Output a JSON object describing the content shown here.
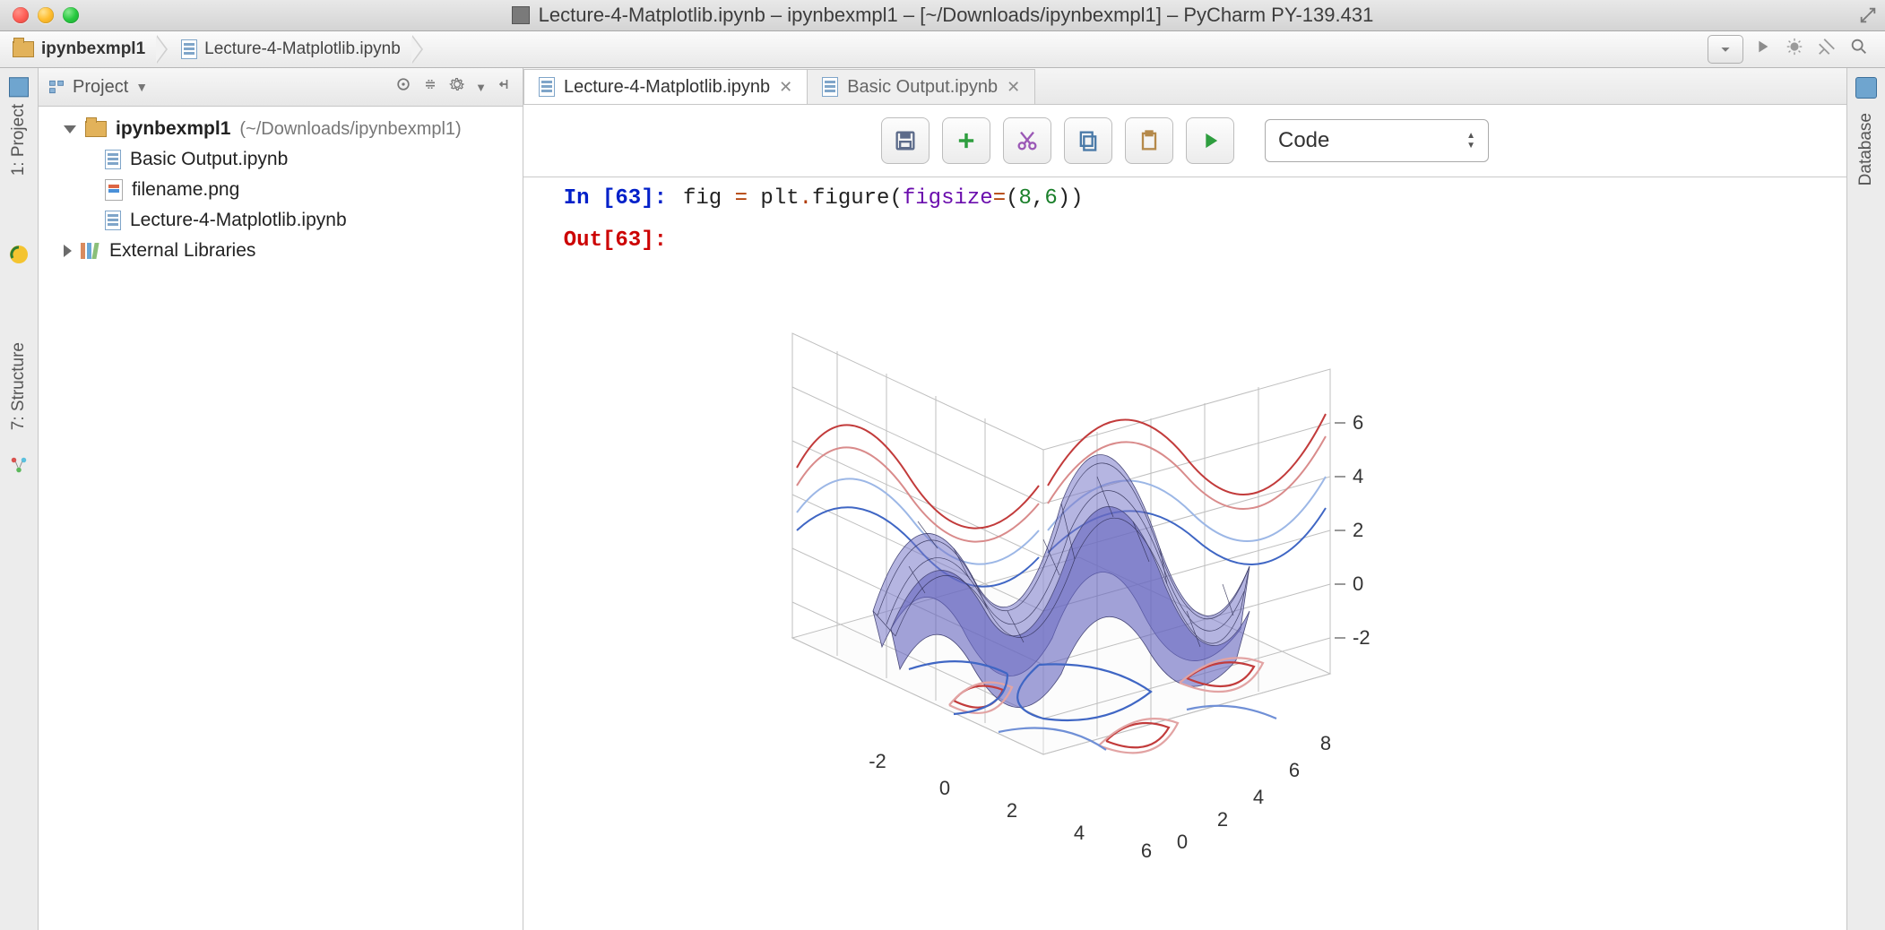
{
  "window": {
    "title": "Lecture-4-Matplotlib.ipynb – ipynbexmpl1 – [~/Downloads/ipynbexmpl1] – PyCharm PY-139.431"
  },
  "breadcrumb": {
    "items": [
      {
        "label": "ipynbexmpl1",
        "bold": true
      },
      {
        "label": "Lecture-4-Matplotlib.ipynb"
      }
    ]
  },
  "left_tool_windows": {
    "project": "1: Project",
    "structure": "7: Structure"
  },
  "right_tool_windows": {
    "database": "Database"
  },
  "project_panel": {
    "title": "Project",
    "root": {
      "name": "ipynbexmpl1",
      "path": "(~/Downloads/ipynbexmpl1)"
    },
    "files": [
      {
        "name": "Basic Output.ipynb",
        "type": "nb"
      },
      {
        "name": "filename.png",
        "type": "png"
      },
      {
        "name": "Lecture-4-Matplotlib.ipynb",
        "type": "nb"
      }
    ],
    "external_libraries_label": "External Libraries"
  },
  "editor_tabs": [
    {
      "label": "Lecture-4-Matplotlib.ipynb",
      "active": true
    },
    {
      "label": "Basic Output.ipynb",
      "active": false
    }
  ],
  "notebook_toolbar": {
    "cell_type": "Code"
  },
  "cell": {
    "in_prompt": "In [63]:",
    "out_prompt": "Out[63]:",
    "code_tokens": {
      "t1": "fig ",
      "op1": "=",
      "t2": " plt",
      "op2": ".",
      "t3": "figure(",
      "arg": "figsize",
      "op3": "=",
      "t4": "(",
      "n1": "8",
      "t5": ",",
      "n2": "6",
      "t6": "))"
    }
  },
  "chart_data": {
    "type": "3d-surface-with-contours",
    "description": "3D wireframe surface z = f(x,y) with contour projections on back walls and floor",
    "x_range": [
      -3,
      6
    ],
    "y_range": [
      0,
      9
    ],
    "z_range": [
      -3,
      7
    ],
    "x_ticks": [
      -2,
      0,
      2,
      4,
      6
    ],
    "y_ticks": [
      0,
      2,
      4,
      6,
      8
    ],
    "z_ticks": [
      -2,
      0,
      2,
      4,
      6
    ],
    "surface": {
      "function_hint": "sinusoidal ripple surface (sin-like in x and y)",
      "colormap": "blue-purple wireframe"
    },
    "contours": {
      "floor": "red/blue contour lines projected on z-min plane",
      "backwalls": "red/blue sinusoidal line profiles on x-z and y-z back planes"
    }
  }
}
